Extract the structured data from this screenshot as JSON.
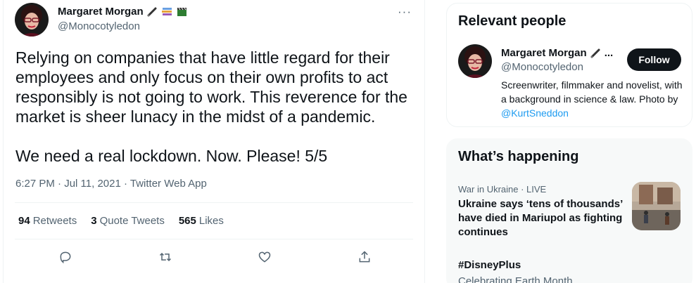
{
  "tweet": {
    "author_name": "Margaret Morgan",
    "author_handle": "@Monocotyledon",
    "more": "···",
    "text": "Relying on companies that have little regard for their employees and only focus on their own profits to act responsibly is not going to work. This reverence for the market is sheer lunacy in the midst of a pandemic.\n\nWe need a real lockdown. Now. Please! 5/5",
    "meta": "6:27 PM · Jul 11, 2021 · Twitter Web App",
    "stats": [
      {
        "count": "94",
        "label": "Retweets"
      },
      {
        "count": "3",
        "label": "Quote Tweets"
      },
      {
        "count": "565",
        "label": "Likes"
      }
    ],
    "actions": [
      "reply-icon",
      "retweet-icon",
      "like-icon",
      "share-icon"
    ]
  },
  "relevant_people": {
    "title": "Relevant people",
    "name": "Margaret Morgan",
    "name_suffix": "...",
    "handle": "@Monocotyledon",
    "follow_label": "Follow",
    "bio": "Screenwriter, filmmaker and novelist, with a background in science & law. Photo by",
    "bio_link": "@KurtSneddon"
  },
  "whats_happening": {
    "title": "What’s happening",
    "trend_category": "War in Ukraine · LIVE",
    "trend_headline": "Ukraine says ‘tens of thousands’ have died in Mariupol as fighting continues",
    "hashtag": "#DisneyPlus",
    "hashtag_sub": "Celebrating Earth Month"
  },
  "colors": {
    "accent": "#1d9bf0",
    "text": "#0f1419",
    "muted": "#536471",
    "border": "#eff3f4"
  }
}
